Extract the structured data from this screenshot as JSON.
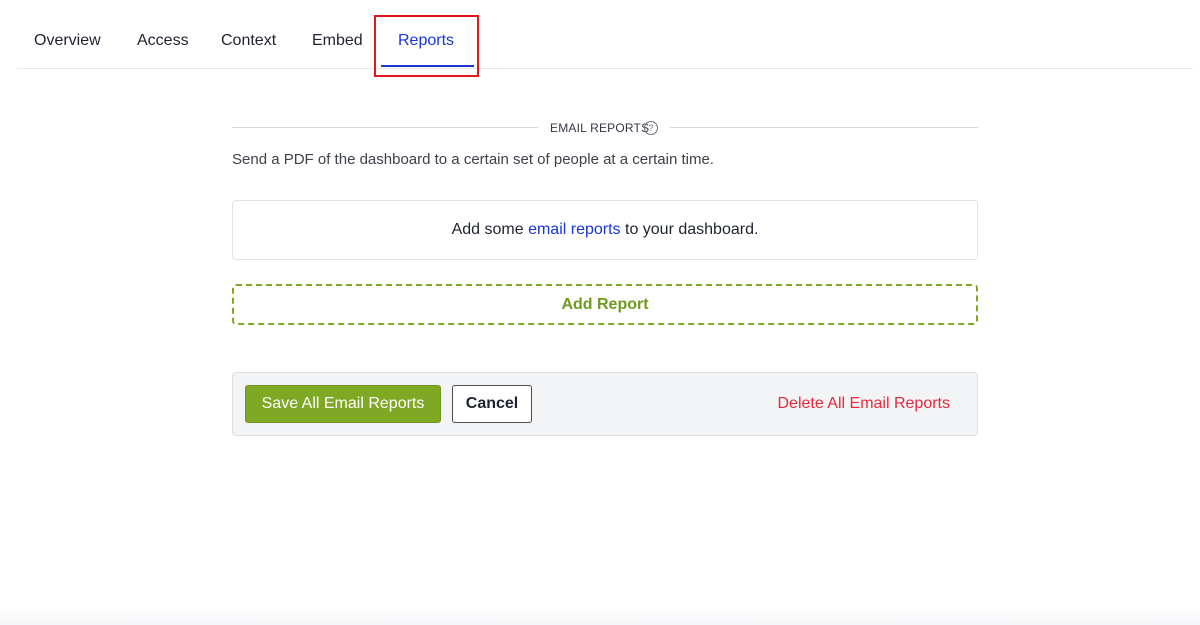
{
  "tabs": [
    {
      "label": "Overview"
    },
    {
      "label": "Access"
    },
    {
      "label": "Context"
    },
    {
      "label": "Embed"
    },
    {
      "label": "Reports",
      "active": true
    }
  ],
  "section": {
    "title": "EMAIL REPORTS",
    "help_glyph": "?",
    "description": "Send a PDF of the dashboard to a certain set of people at a certain time."
  },
  "empty_state": {
    "prefix": "Add some ",
    "link": "email reports",
    "suffix": " to your dashboard."
  },
  "add_report": {
    "label": "Add Report"
  },
  "footer": {
    "save_label": "Save All Email Reports",
    "cancel_label": "Cancel",
    "delete_label": "Delete All Email Reports"
  },
  "colors": {
    "accent_blue": "#1a35d6",
    "green": "#7fa825",
    "danger_red": "#e8283c",
    "highlight_red": "#e5161b"
  }
}
